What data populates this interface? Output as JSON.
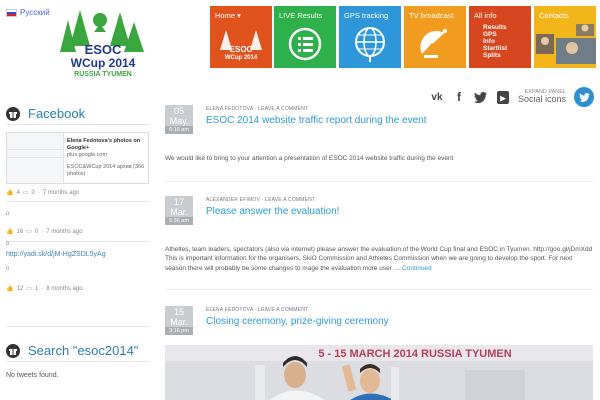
{
  "lang": {
    "label": "Русский"
  },
  "logo": {
    "line1": "ESOC",
    "line2": "WCup 2014",
    "line3": "RUSSIA TYUMEN"
  },
  "nav": [
    {
      "label": "Home",
      "color": "#e0531d",
      "icon": "home-logo"
    },
    {
      "label": "LIVE Results",
      "color": "#2eb04a",
      "icon": "list-icon"
    },
    {
      "label": "GPS tracking",
      "color": "#2d97d9",
      "icon": "globe-icon"
    },
    {
      "label": "TV broadcast",
      "color": "#f19c1f",
      "icon": "satellite-icon"
    },
    {
      "label": "All info",
      "color": "#d6461f",
      "icon": "all-info-icon",
      "sublines": [
        "Results",
        "GPS",
        "Info",
        "Startlist",
        "Splits"
      ]
    },
    {
      "label": "Contacts",
      "color": "#f2b61a",
      "icon": "contacts-photos"
    }
  ],
  "social": {
    "icons": [
      "vk-icon",
      "facebook-icon",
      "twitter-icon",
      "youtube-icon"
    ],
    "expand_label": "EXPAND PANEL",
    "expand_title": "Social icons"
  },
  "sidebar": {
    "facebook_title": "Facebook",
    "fb_card": {
      "title": "Elena Fedotova's photos on Google+",
      "source": "plus.google.com",
      "desc": "ESOC&WCup 2014 архив (366 photos)"
    },
    "fb_posts": [
      {
        "likes": "4",
        "comments": "0",
        "time": "7 months ago"
      },
      {
        "text": "o",
        "likes": "16",
        "comments": "0",
        "time": "7 months ago"
      },
      {
        "text": "o",
        "link": "http://yadi.sk/d/jM-HgZSDL5yAg",
        "likes": "12",
        "comments": "1",
        "time": "8 months ago"
      }
    ],
    "search_title": "Search \"esoc2014\"",
    "no_tweets": "No tweets found."
  },
  "posts": [
    {
      "day": "05",
      "month": "May.",
      "time": "6:16 am",
      "author": "ELENA FEDOTOVA",
      "comment": "LEAVE A COMMENT",
      "title": "ESOC 2014 website traffic report during the event",
      "text": "We would like to bring to your attention a presentation of ESOC 2014 website traffic during the event"
    },
    {
      "day": "17",
      "month": "Mar.",
      "time": "5:36 am",
      "author": "ALEXANDER EFIMOV",
      "comment": "LEAVE A COMMENT",
      "title": "Please answer the evaluation!",
      "text": "Atheltes, team leaders, spectators (also via internet) please answer the evaluation of the World Cup final and ESOC in Tyumen. http://goo.gl/jDmXdd This is important information for the organisers, SkiO Commission and Athletes Commission when we are going to develop the sport. For next season there will probably be some changes to mage the evaluation more user …",
      "continue": "Continued"
    },
    {
      "day": "15",
      "month": "Mar.",
      "time": "3:16 pm",
      "author": "ELENA FEDOTOVA",
      "comment": "LEAVE A COMMENT",
      "title": "Closing ceremony, prize-giving ceremony",
      "photo_banner": "5 - 15 MARCH 2014 RUSSIA TYUMEN"
    }
  ]
}
